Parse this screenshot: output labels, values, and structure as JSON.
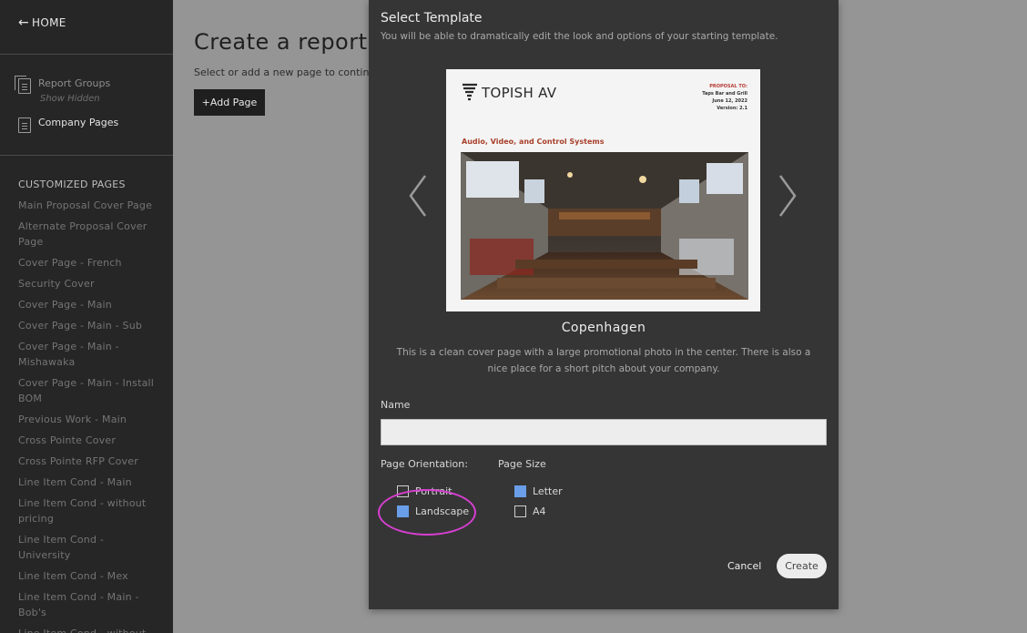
{
  "sidebar": {
    "home_label": "HOME",
    "report_groups_label": "Report Groups",
    "show_hidden_label": "Show Hidden",
    "company_pages_label": "Company Pages",
    "customized_title": "CUSTOMIZED PAGES",
    "customized_items": [
      "Main Proposal Cover Page",
      "Alternate Proposal Cover Page",
      "Cover Page - French",
      "Security Cover",
      "Cover Page - Main",
      "Cover Page - Main - Sub",
      "Cover Page - Main - Mishawaka",
      "Cover Page - Main - Install BOM",
      "Previous Work - Main",
      "Cross Pointe Cover",
      "Cross Pointe RFP Cover",
      "Line Item Cond - Main",
      "Line Item Cond - without pricing",
      "Line Item Cond - University",
      "Line Item Cond - Mex",
      "Line Item Cond - Main - Bob's",
      "Line Item Cond - without"
    ]
  },
  "main": {
    "title": "Create a report page",
    "subtitle": "Select or add a new page to continue.",
    "add_page_label": "+Add Page"
  },
  "modal": {
    "title": "Select Template",
    "subtitle": "You will be able to dramatically edit the look and options of your starting template.",
    "preview": {
      "brand": "TOPISH AV",
      "proposal_to": "PROPOSAL TO:",
      "client": "Taps Bar and Grill",
      "date": "June 12, 2022",
      "version": "Version: 2.1",
      "heading": "Audio, Video, and Control Systems"
    },
    "template_name": "Copenhagen",
    "template_desc": "This is a clean cover page with a large promotional photo in the center. There is also a nice place for a short pitch about your company.",
    "name_label": "Name",
    "name_value": "",
    "orientation_label": "Page Orientation:",
    "orientation_options": [
      {
        "label": "Portrait",
        "checked": false
      },
      {
        "label": "Landscape",
        "checked": true
      }
    ],
    "size_label": "Page Size",
    "size_options": [
      {
        "label": "Letter",
        "checked": true
      },
      {
        "label": "A4",
        "checked": false
      }
    ],
    "cancel_label": "Cancel",
    "create_label": "Create"
  },
  "colors": {
    "checkbox_accent": "#6a9ee8",
    "highlight_ring": "#d63fd1"
  }
}
